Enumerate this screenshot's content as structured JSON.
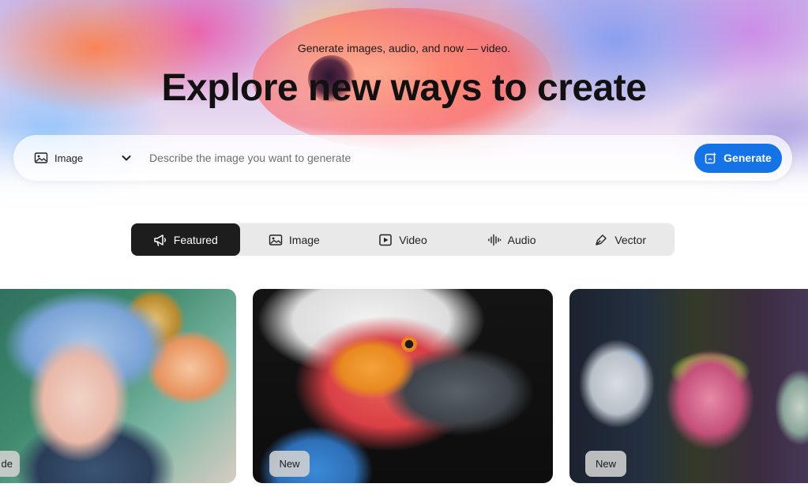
{
  "hero": {
    "subtitle": "Generate images, audio, and now — video.",
    "title": "Explore new ways to create"
  },
  "prompt": {
    "type_label": "Image",
    "type_icon": "image-icon",
    "placeholder": "Describe the image you want to generate",
    "generate_label": "Generate",
    "generate_icon": "sparkle-generate-icon"
  },
  "tabs": [
    {
      "label": "Featured",
      "icon": "megaphone-icon",
      "active": true
    },
    {
      "label": "Image",
      "icon": "image-icon",
      "active": false
    },
    {
      "label": "Video",
      "icon": "play-icon",
      "active": false
    },
    {
      "label": "Audio",
      "icon": "waveform-icon",
      "active": false
    },
    {
      "label": "Vector",
      "icon": "pen-icon",
      "active": false
    }
  ],
  "cards": [
    {
      "badge": "de",
      "subject": "anime-portrait"
    },
    {
      "badge": "New",
      "subject": "parrot"
    },
    {
      "badge": "New",
      "subject": "robots"
    }
  ],
  "colors": {
    "accent": "#1473e6",
    "active_tab": "#1d1d1d",
    "tabs_bg": "#e9e9e9"
  }
}
